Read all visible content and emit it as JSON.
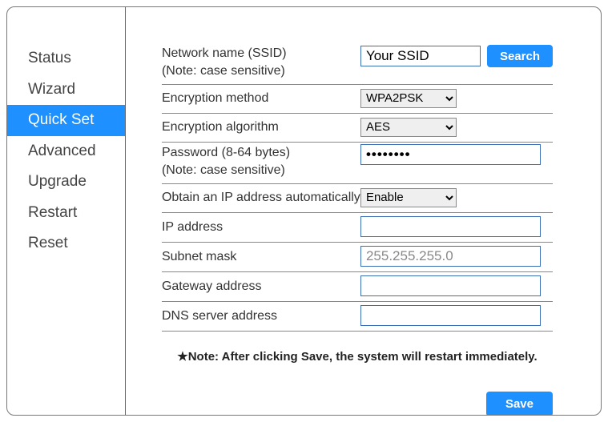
{
  "sidebar": {
    "items": [
      {
        "label": "Status"
      },
      {
        "label": "Wizard"
      },
      {
        "label": "Quick Set",
        "active": true
      },
      {
        "label": "Advanced"
      },
      {
        "label": "Upgrade"
      },
      {
        "label": "Restart"
      },
      {
        "label": "Reset"
      }
    ]
  },
  "form": {
    "ssid": {
      "label": "Network name (SSID)",
      "note": "(Note: case sensitive)",
      "value": "Your SSID",
      "search_btn": "Search"
    },
    "enc_method": {
      "label": "Encryption method",
      "value": "WPA2PSK"
    },
    "enc_algo": {
      "label": "Encryption algorithm",
      "value": "AES"
    },
    "password": {
      "label": "Password (8-64 bytes)",
      "note": "(Note: case sensitive)",
      "value": "••••••••"
    },
    "dhcp": {
      "label": "Obtain an IP address automatically",
      "value": "Enable"
    },
    "ip": {
      "label": "IP address",
      "value": ""
    },
    "mask": {
      "label": "Subnet mask",
      "placeholder": "255.255.255.0",
      "value": ""
    },
    "gateway": {
      "label": "Gateway address",
      "value": ""
    },
    "dns": {
      "label": "DNS server address",
      "value": ""
    }
  },
  "footer": {
    "note": "★Note: After clicking Save, the system will restart immediately.",
    "save_btn": "Save"
  }
}
